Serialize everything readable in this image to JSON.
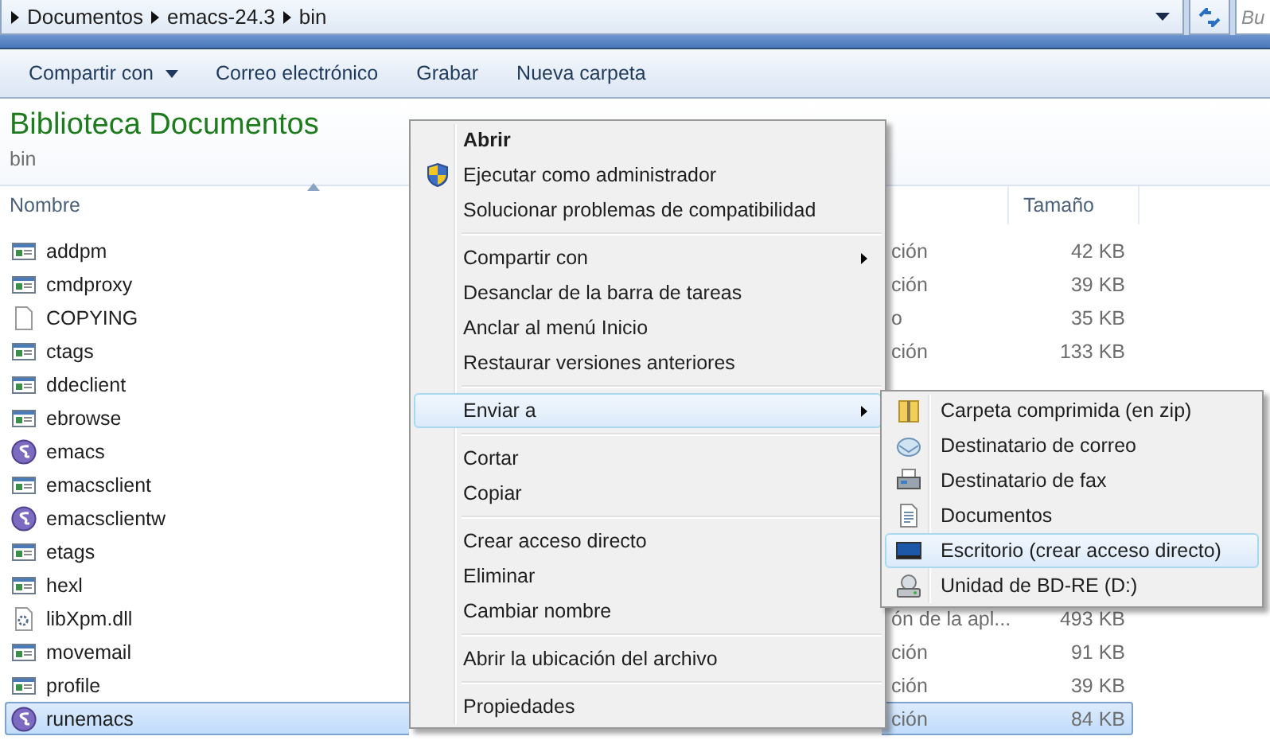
{
  "breadcrumbs": [
    "Documentos",
    "emacs-24.3",
    "bin"
  ],
  "search": {
    "placeholder": "Bu"
  },
  "toolbar": [
    {
      "label": "Compartir con",
      "dropdown": true
    },
    {
      "label": "Correo electrónico",
      "dropdown": false
    },
    {
      "label": "Grabar",
      "dropdown": false
    },
    {
      "label": "Nueva carpeta",
      "dropdown": false
    }
  ],
  "library": {
    "title": "Biblioteca Documentos",
    "subtitle": "bin"
  },
  "columns": [
    "Nombre",
    "Tamaño"
  ],
  "files": [
    {
      "name": "addpm",
      "kind": "exe",
      "type": "ción",
      "size": "42 KB",
      "selected": false
    },
    {
      "name": "cmdproxy",
      "kind": "exe",
      "type": "ción",
      "size": "39 KB",
      "selected": false
    },
    {
      "name": "COPYING",
      "kind": "file",
      "type": "o",
      "size": "35 KB",
      "selected": false
    },
    {
      "name": "ctags",
      "kind": "exe",
      "type": "ción",
      "size": "133 KB",
      "selected": false
    },
    {
      "name": "ddeclient",
      "kind": "exe",
      "selected": false
    },
    {
      "name": "ebrowse",
      "kind": "exe",
      "selected": false
    },
    {
      "name": "emacs",
      "kind": "emacs",
      "selected": false
    },
    {
      "name": "emacsclient",
      "kind": "exe",
      "selected": false
    },
    {
      "name": "emacsclientw",
      "kind": "emacs",
      "selected": false
    },
    {
      "name": "etags",
      "kind": "exe",
      "selected": false
    },
    {
      "name": "hexl",
      "kind": "exe",
      "selected": false
    },
    {
      "name": "libXpm.dll",
      "kind": "dll",
      "type": "ón de la apl...",
      "size": "493 KB",
      "selected": false
    },
    {
      "name": "movemail",
      "kind": "exe",
      "type": "ción",
      "size": "91 KB",
      "selected": false
    },
    {
      "name": "profile",
      "kind": "exe",
      "type": "ción",
      "size": "39 KB",
      "selected": false
    },
    {
      "name": "runemacs",
      "kind": "emacs",
      "type": "ción",
      "size": "84 KB",
      "selected": true
    }
  ],
  "context_menu": [
    {
      "kind": "item",
      "label": "Abrir",
      "default": true,
      "selected": false
    },
    {
      "kind": "admin_item",
      "label": "Ejecutar como administrador",
      "selected": false
    },
    {
      "kind": "item",
      "label": "Solucionar problemas de compatibilidad",
      "selected": false
    },
    {
      "kind": "separator"
    },
    {
      "kind": "item",
      "label": "Compartir con",
      "submenu": true,
      "selected": false
    },
    {
      "kind": "item",
      "label": "Desanclar de la barra de tareas",
      "selected": false
    },
    {
      "kind": "item",
      "label": "Anclar al menú Inicio",
      "selected": false
    },
    {
      "kind": "item",
      "label": "Restaurar versiones anteriores",
      "selected": false
    },
    {
      "kind": "separator"
    },
    {
      "kind": "item",
      "label": "Enviar a",
      "submenu": true,
      "selected": true
    },
    {
      "kind": "separator"
    },
    {
      "kind": "item",
      "label": "Cortar",
      "selected": false
    },
    {
      "kind": "item",
      "label": "Copiar",
      "selected": false
    },
    {
      "kind": "separator"
    },
    {
      "kind": "item",
      "label": "Crear acceso directo",
      "selected": false
    },
    {
      "kind": "item",
      "label": "Eliminar",
      "selected": false
    },
    {
      "kind": "item",
      "label": "Cambiar nombre",
      "selected": false
    },
    {
      "kind": "separator"
    },
    {
      "kind": "item",
      "label": "Abrir la ubicación del archivo",
      "selected": false
    },
    {
      "kind": "separator"
    },
    {
      "kind": "item",
      "label": "Propiedades",
      "selected": false
    }
  ],
  "send_to_menu": [
    {
      "label": "Carpeta comprimida (en zip)",
      "kind": "zip",
      "selected": false
    },
    {
      "label": "Destinatario de correo",
      "kind": "mail",
      "selected": false
    },
    {
      "label": "Destinatario de fax",
      "kind": "fax",
      "selected": false
    },
    {
      "label": "Documentos",
      "kind": "doc",
      "selected": false
    },
    {
      "label": "Escritorio (crear acceso directo)",
      "kind": "desktop",
      "selected": true
    },
    {
      "label": "Unidad de BD-RE (D:)",
      "kind": "drive",
      "selected": false
    }
  ]
}
